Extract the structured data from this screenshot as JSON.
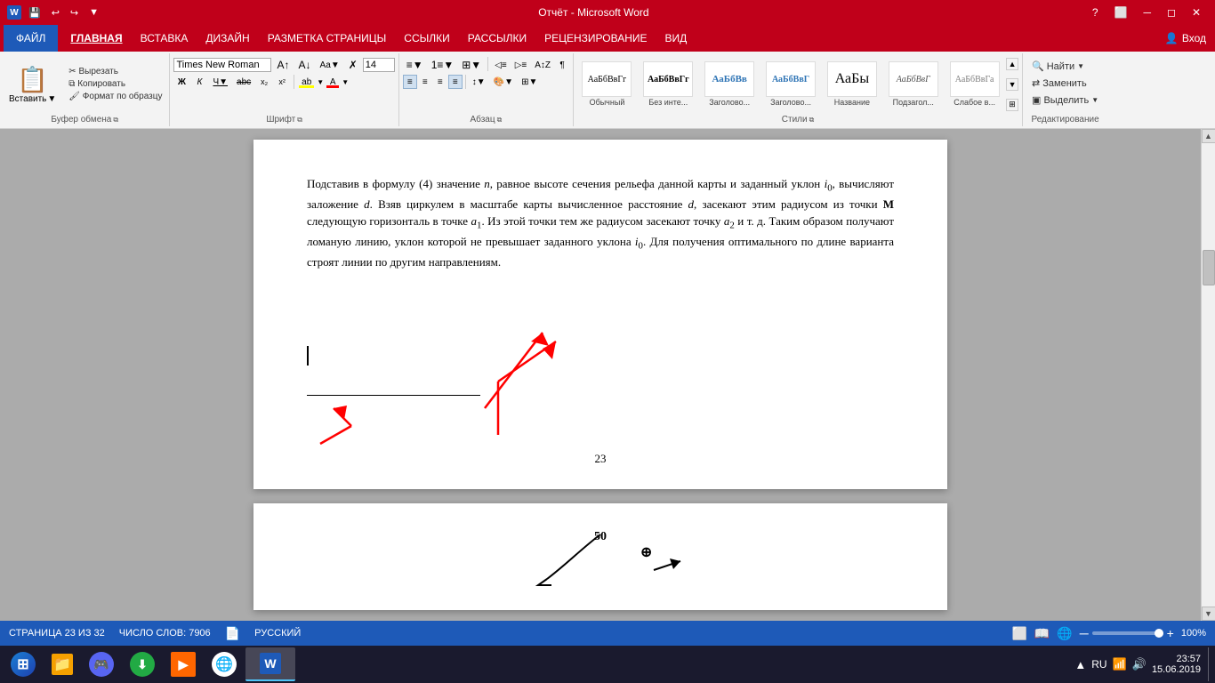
{
  "titleBar": {
    "title": "Отчёт - Microsoft Word",
    "quickAccess": [
      "save",
      "undo",
      "redo",
      "customize"
    ],
    "windowControls": [
      "help",
      "restore",
      "minimize",
      "maximize",
      "close"
    ]
  },
  "menuBar": {
    "fileBtn": "ФАЙЛ",
    "items": [
      "ГЛАВНАЯ",
      "ВСТАВКА",
      "ДИЗАЙН",
      "РАЗМЕТКА СТРАНИЦЫ",
      "ССЫЛКИ",
      "РАССЫЛКИ",
      "РЕЦЕНЗИРОВАНИЕ",
      "ВИД"
    ],
    "signIn": "Вход"
  },
  "ribbon": {
    "clipboard": {
      "label": "Буфер обмена",
      "paste": "Вставить",
      "cut": "Вырезать",
      "copy": "Копировать",
      "formatPainter": "Формат по образцу"
    },
    "font": {
      "label": "Шрифт",
      "fontName": "Times New Roman",
      "fontSize": "14",
      "buttons": [
        "B",
        "K",
        "Ч",
        "abc",
        "x₂",
        "x²"
      ],
      "growFont": "А↑",
      "shrinkFont": "А↓",
      "changeCase": "Аа",
      "clearFormatting": "✗",
      "highlightColor": "ab",
      "fontColor": "А"
    },
    "paragraph": {
      "label": "Абзац"
    },
    "styles": {
      "label": "Стили",
      "items": [
        {
          "name": "Обычный",
          "preview": "АаБбВвГг",
          "variant": "normal"
        },
        {
          "name": "Без инте...",
          "preview": "АаБбВвГг",
          "variant": "no-spacing"
        },
        {
          "name": "Заголово...",
          "preview": "АаБбВв",
          "variant": "heading1"
        },
        {
          "name": "Заголово...",
          "preview": "АаБбВвГ",
          "variant": "heading2"
        },
        {
          "name": "Название",
          "preview": "АаБы",
          "variant": "title"
        },
        {
          "name": "Подзагол...",
          "preview": "АаБбВвГ",
          "variant": "subtitle"
        },
        {
          "name": "Слабое в...",
          "preview": "АаБбВвГа",
          "variant": "subtle"
        }
      ]
    },
    "editing": {
      "label": "Редактирование",
      "find": "Найти",
      "replace": "Заменить",
      "select": "Выделить"
    }
  },
  "document": {
    "page1": {
      "text": "Подставив в формулу (4) значение n, равное высоте сечения рельефа данной карты и заданный уклон i₀, вычисляют заложение d. Взяв циркулем в масштабе карты вычисленное расстояние d, засекают этим радиусом из точки M следующую горизонталь в точке a₁. Из этой точки тем же радиусом засекают точку a₂ и т. д. Таким образом получают ломаную линию, уклон которой не превышает заданного уклона i₀. Для получения оптимального по длине варианта строят линии по другим направлениям.",
      "pageNumber": "23"
    },
    "page2": {
      "topNumber": "50"
    }
  },
  "statusBar": {
    "page": "СТРАНИЦА 23 ИЗ 32",
    "wordCount": "ЧИСЛО СЛОВ: 7906",
    "language": "РУССКИЙ",
    "zoom": "100%"
  },
  "taskbar": {
    "items": [
      {
        "name": "start",
        "label": "Start"
      },
      {
        "name": "explorer",
        "label": "File Explorer"
      },
      {
        "name": "discord",
        "label": "Discord"
      },
      {
        "name": "downloader",
        "label": "Downloader"
      },
      {
        "name": "media",
        "label": "Media Player"
      },
      {
        "name": "chrome",
        "label": "Google Chrome"
      },
      {
        "name": "word",
        "label": "Microsoft Word",
        "active": true
      }
    ],
    "tray": {
      "language": "RU",
      "time": "23:57",
      "date": "15.06.2019"
    }
  }
}
